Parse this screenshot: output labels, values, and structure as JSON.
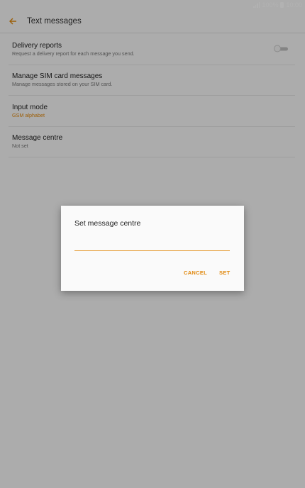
{
  "status_bar": {
    "battery": "100%",
    "time": "10:00"
  },
  "app_bar": {
    "title": "Text messages"
  },
  "settings": [
    {
      "title": "Delivery reports",
      "subtitle": "Request a delivery report for each message you send."
    },
    {
      "title": "Manage SIM card messages",
      "subtitle": "Manage messages stored on your SIM card."
    },
    {
      "title": "Input mode",
      "subtitle": "GSM alphabet"
    },
    {
      "title": "Message centre",
      "subtitle": "Not set"
    }
  ],
  "delivery_reports_enabled": false,
  "dialog": {
    "title": "Set message centre",
    "input_value": "",
    "cancel_label": "CANCEL",
    "set_label": "SET"
  },
  "colors": {
    "accent": "#e0870b",
    "scrim": "rgba(0,0,0,0.3)"
  },
  "icons": [
    "signal-icon",
    "battery-icon",
    "back-arrow-icon"
  ]
}
